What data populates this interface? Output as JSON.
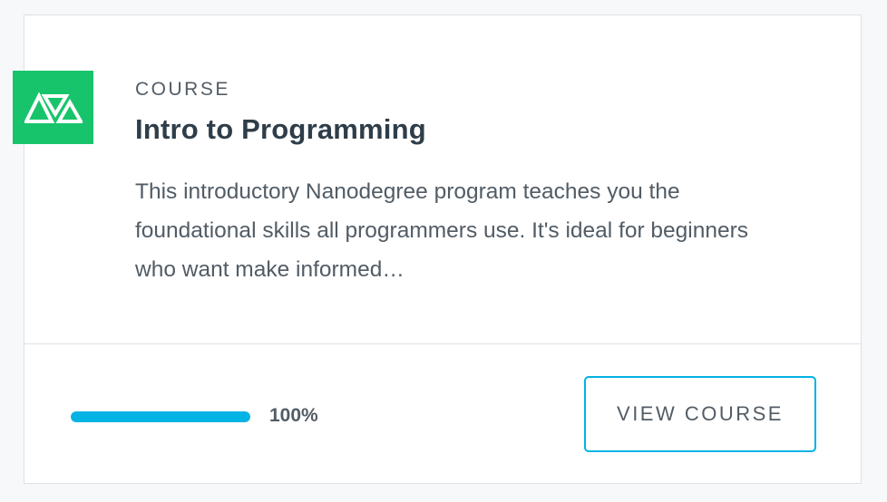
{
  "card": {
    "eyebrow": "COURSE",
    "title": "Intro to Programming",
    "description": "This introductory Nanodegree program teaches you the foundational skills all programmers use. It's ideal for beginners who want make informed…",
    "logo_icon": "udacity-logo-icon",
    "progress_percent": 100,
    "progress_label": "100%",
    "button_label": "VIEW COURSE"
  },
  "colors": {
    "logo_bg": "#18c46b",
    "accent": "#02b3e4",
    "title": "#2e3d49",
    "text": "#525c65",
    "border": "#dbe2e8",
    "page_bg": "#f7f8fa"
  }
}
